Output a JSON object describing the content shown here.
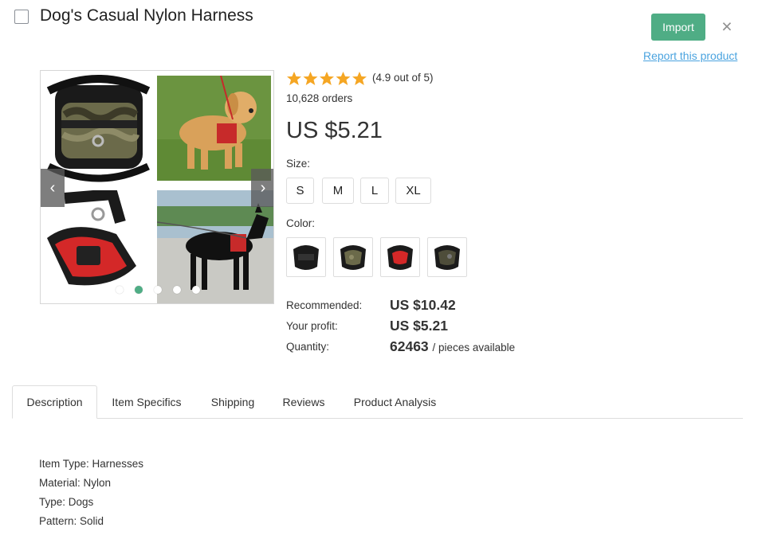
{
  "product": {
    "title": "Dog's Casual Nylon Harness",
    "rating_text": "(4.9 out of 5)",
    "rating_value": 4.9,
    "rating_max": 5,
    "orders": "10,628 orders",
    "price": "US $5.21"
  },
  "actions": {
    "import_label": "Import",
    "close_glyph": "×",
    "report_label": "Report this product"
  },
  "gallery": {
    "prev_glyph": "‹",
    "next_glyph": "›",
    "dots": 5,
    "active_dot": 1
  },
  "options": {
    "size_label": "Size:",
    "sizes": [
      "S",
      "M",
      "L",
      "XL"
    ],
    "color_label": "Color:",
    "colors": [
      "black",
      "camo",
      "red",
      "camo-dark"
    ]
  },
  "pricing": {
    "recommended_label": "Recommended:",
    "recommended_value": "US $10.42",
    "profit_label": "Your profit:",
    "profit_value": "US $5.21",
    "quantity_label": "Quantity:",
    "quantity_value": "62463",
    "quantity_suffix": "/ pieces available"
  },
  "tabs": [
    "Description",
    "Item Specifics",
    "Shipping",
    "Reviews",
    "Product Analysis"
  ],
  "active_tab": 0,
  "description": [
    "Item Type: Harnesses",
    "Material: Nylon",
    "Type: Dogs",
    "Pattern: Solid"
  ],
  "colors": {
    "accent": "#4fad85",
    "link": "#4aa3df",
    "star": "#f5a623"
  }
}
